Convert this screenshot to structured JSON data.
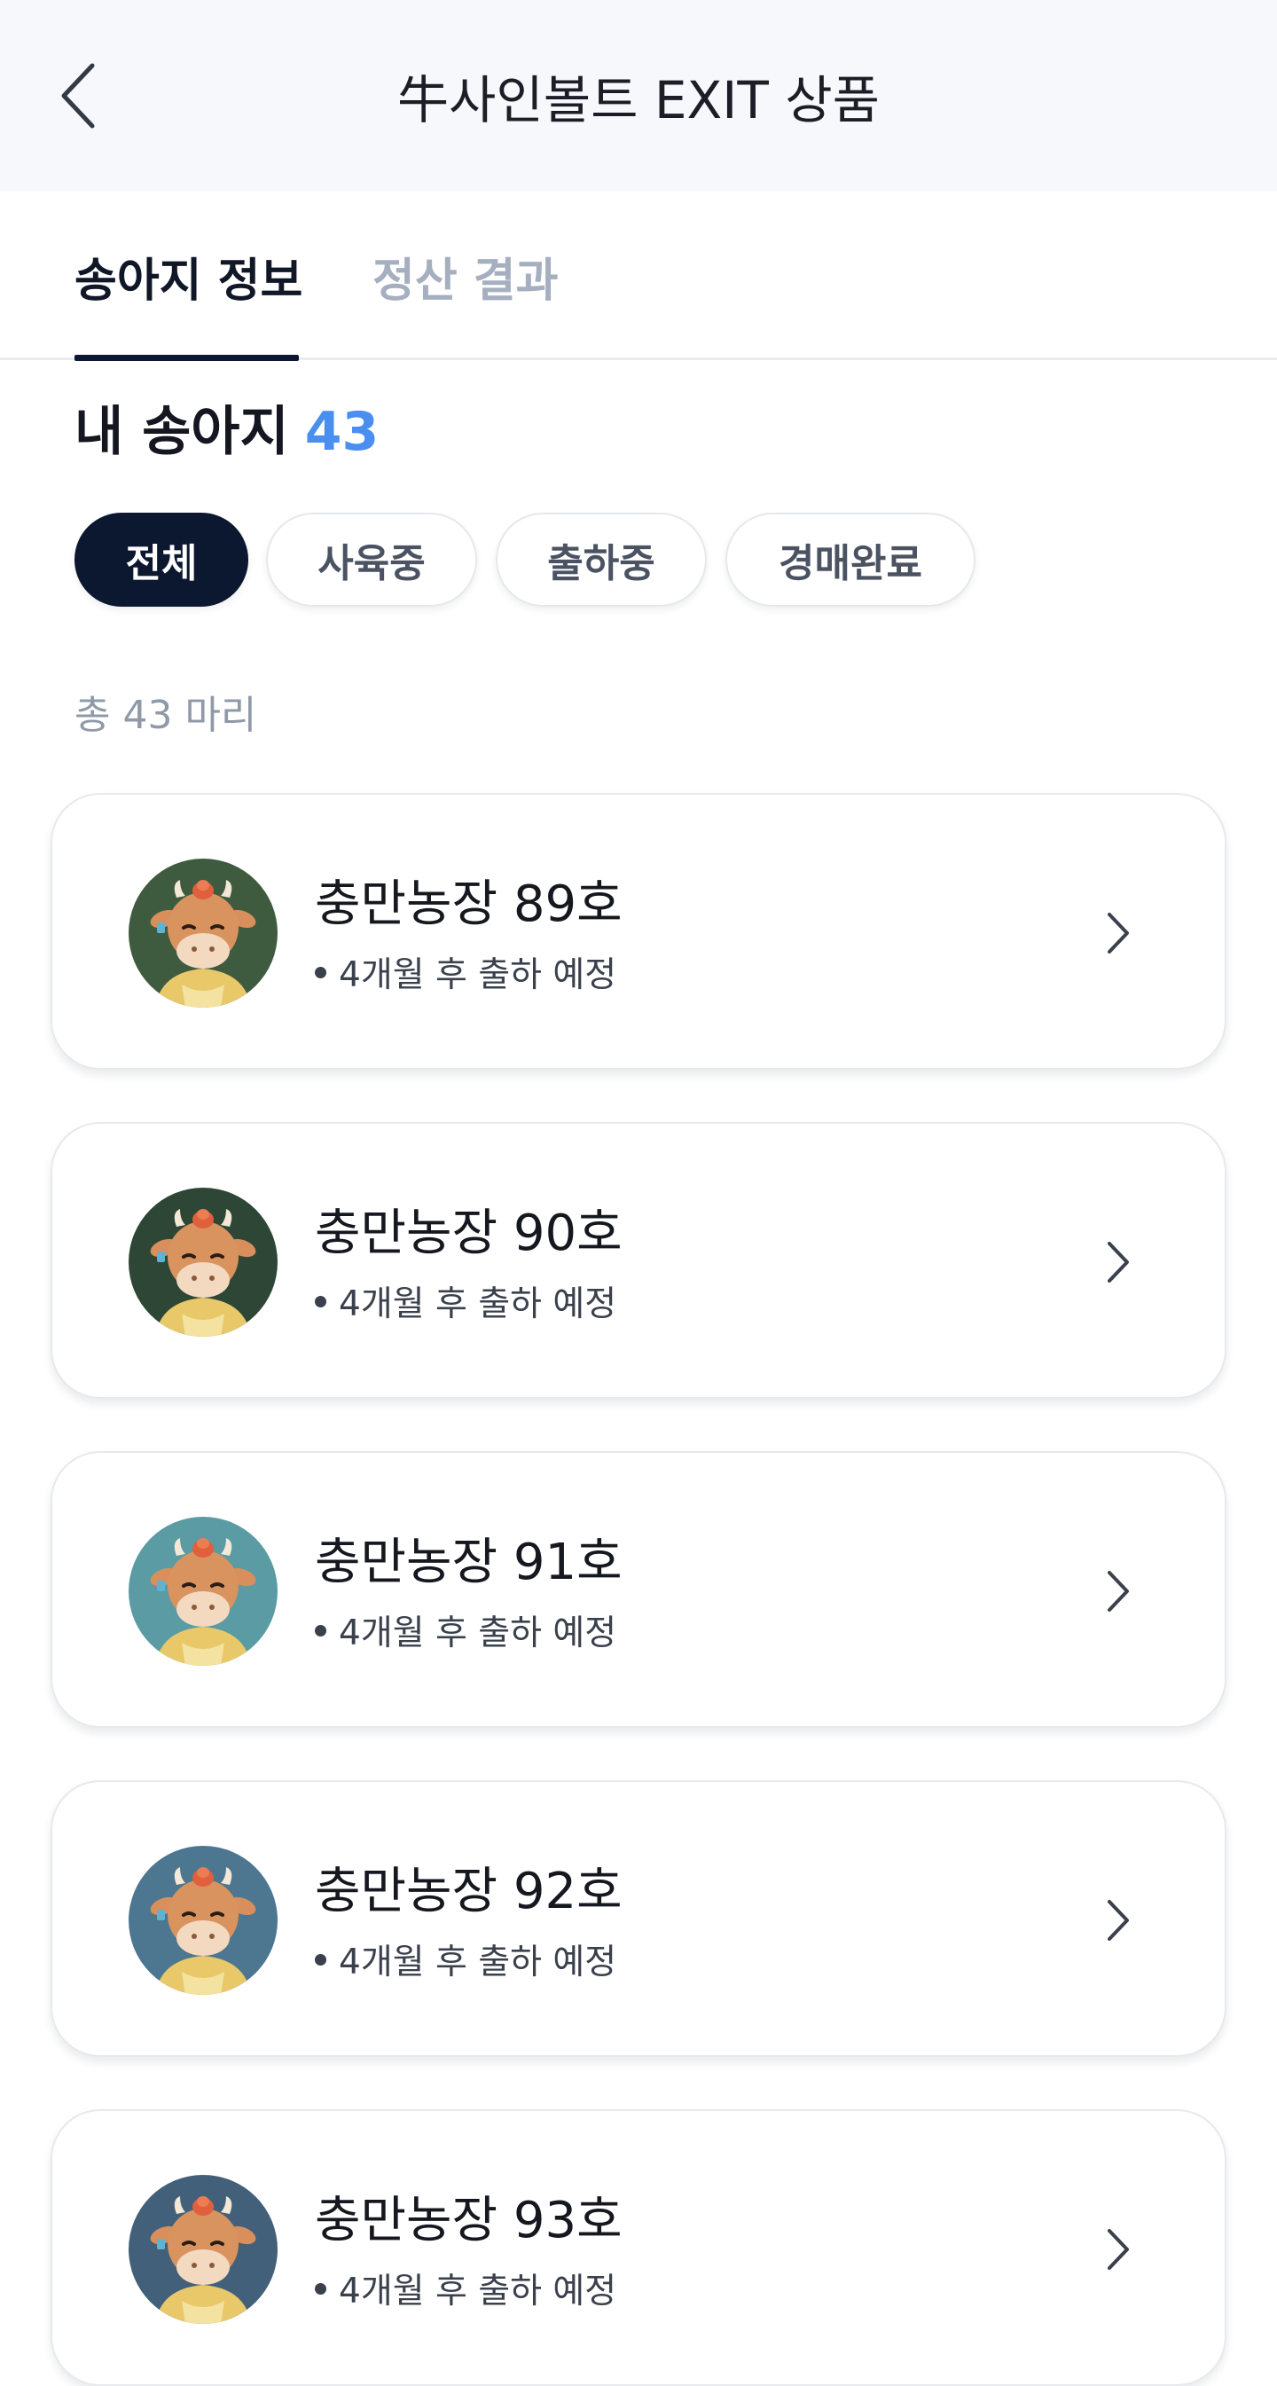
{
  "header": {
    "title": "牛사인볼트 EXIT 상품",
    "back_icon": "chevron-left-icon"
  },
  "tabs": [
    {
      "label": "송아지 정보",
      "active": true
    },
    {
      "label": "정산 결과",
      "active": false
    }
  ],
  "section": {
    "title": "내 송아지",
    "count": "43"
  },
  "filters": [
    {
      "label": "전체",
      "active": true
    },
    {
      "label": "사육중",
      "active": false
    },
    {
      "label": "출하중",
      "active": false
    },
    {
      "label": "경매완료",
      "active": false
    }
  ],
  "total_text": "총 43 마리",
  "cards": [
    {
      "title": "충만농장 89호",
      "status": "4개월 후 출하 예정",
      "avatar_bg": "#3f5b3f",
      "icon": "cow-avatar-icon"
    },
    {
      "title": "충만농장 90호",
      "status": "4개월 후 출하 예정",
      "avatar_bg": "#2e4636",
      "icon": "cow-avatar-icon"
    },
    {
      "title": "충만농장 91호",
      "status": "4개월 후 출하 예정",
      "avatar_bg": "#5b9ba3",
      "icon": "cow-avatar-icon"
    },
    {
      "title": "충만농장 92호",
      "status": "4개월 후 출하 예정",
      "avatar_bg": "#4d7690",
      "icon": "cow-avatar-icon"
    },
    {
      "title": "충만농장 93호",
      "status": "4개월 후 출하 예정",
      "avatar_bg": "#43607a",
      "icon": "cow-avatar-icon"
    }
  ],
  "colors": {
    "accent": "#4a8ef0",
    "dark": "#0c1730",
    "muted": "#a5afbf"
  }
}
